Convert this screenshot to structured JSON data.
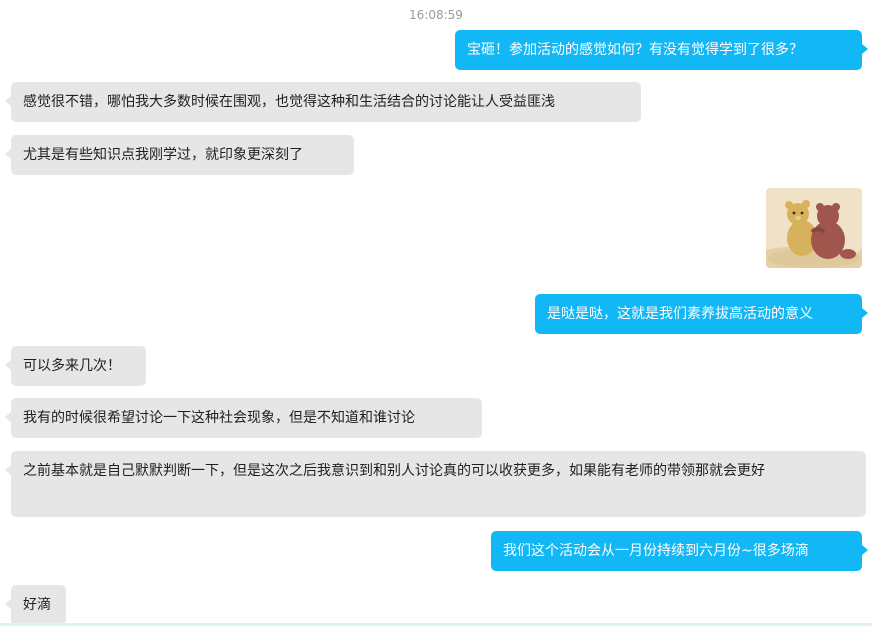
{
  "chat": {
    "timestamp": "16:08:59",
    "messages": [
      {
        "side": "out",
        "text": "宝砸！参加活动的感觉如何？有没有觉得学到了很多？"
      },
      {
        "side": "in",
        "text": "感觉很不错，哪怕我大多数时候在围观，也觉得这种和生活结合的讨论能让人受益匪浅"
      },
      {
        "side": "in",
        "text": "尤其是有些知识点我刚学过，就印象更深刻了"
      },
      {
        "side": "out",
        "sticker": "bear-hug-sticker"
      },
      {
        "side": "out",
        "text": "是哒是哒，这就是我们素养拔高活动的意义"
      },
      {
        "side": "in",
        "text": "可以多来几次！"
      },
      {
        "side": "in",
        "text": "我有的时候很希望讨论一下这种社会现象，但是不知道和谁讨论"
      },
      {
        "side": "in",
        "text": "之前基本就是自己默默判断一下，但是这次之后我意识到和别人讨论真的可以收获更多，如果能有老师的带领那就会更好"
      },
      {
        "side": "out",
        "text": "我们这个活动会从一月份持续到六月份~很多场滴"
      },
      {
        "side": "in",
        "text": "好滴"
      }
    ]
  },
  "colors": {
    "outgoing_bubble": "#12b7f5",
    "incoming_bubble": "#e6e6e6",
    "timestamp": "#9a9a9a"
  }
}
